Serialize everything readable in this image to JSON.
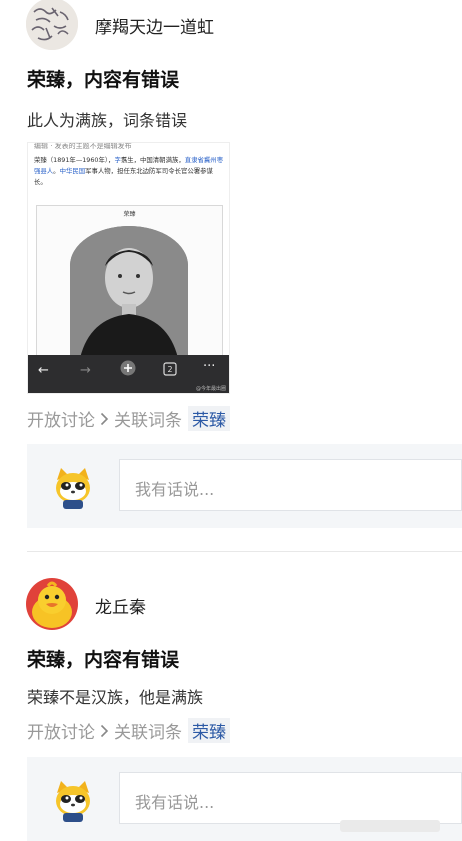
{
  "posts": [
    {
      "username": "摩羯天边一道虹",
      "title": "荣臻，内容有错误",
      "content": "此人为满族，词条错误",
      "screenshot": {
        "top_snippet": "编辑 · 发表的主题不是编辑发布",
        "text_parts": [
          "荣臻（1891年—1960年），",
          "字",
          "翥生，中国清朝满族，",
          "直隶省冀州枣强县人",
          "。",
          "中华民国",
          "军事人物，担任东北边防军司令长官公署参谋长。"
        ],
        "infobox_title": "荣臻",
        "watermark": "@今年最出圈"
      },
      "meta": {
        "open_discussion": "开放讨论",
        "related_term": "关联词条",
        "tag": "荣臻"
      },
      "reply_placeholder": "我有话说..."
    },
    {
      "username": "龙丘秦",
      "title": "荣臻，内容有错误",
      "content": "荣臻不是汉族，他是满族",
      "meta": {
        "open_discussion": "开放讨论",
        "related_term": "关联词条",
        "tag": "荣臻"
      },
      "reply_placeholder": "我有话说..."
    }
  ],
  "icons": {
    "chevron": "chevron-right-icon",
    "nav": [
      "back-arrow-icon",
      "forward-arrow-icon",
      "new-tab-plus-icon",
      "tab-count-icon",
      "more-icon"
    ]
  },
  "colors": {
    "tag_text": "#2d5aa6",
    "tag_bg": "#f0f2f5",
    "meta_text": "#999999",
    "reply_bg": "#f4f6f8"
  }
}
